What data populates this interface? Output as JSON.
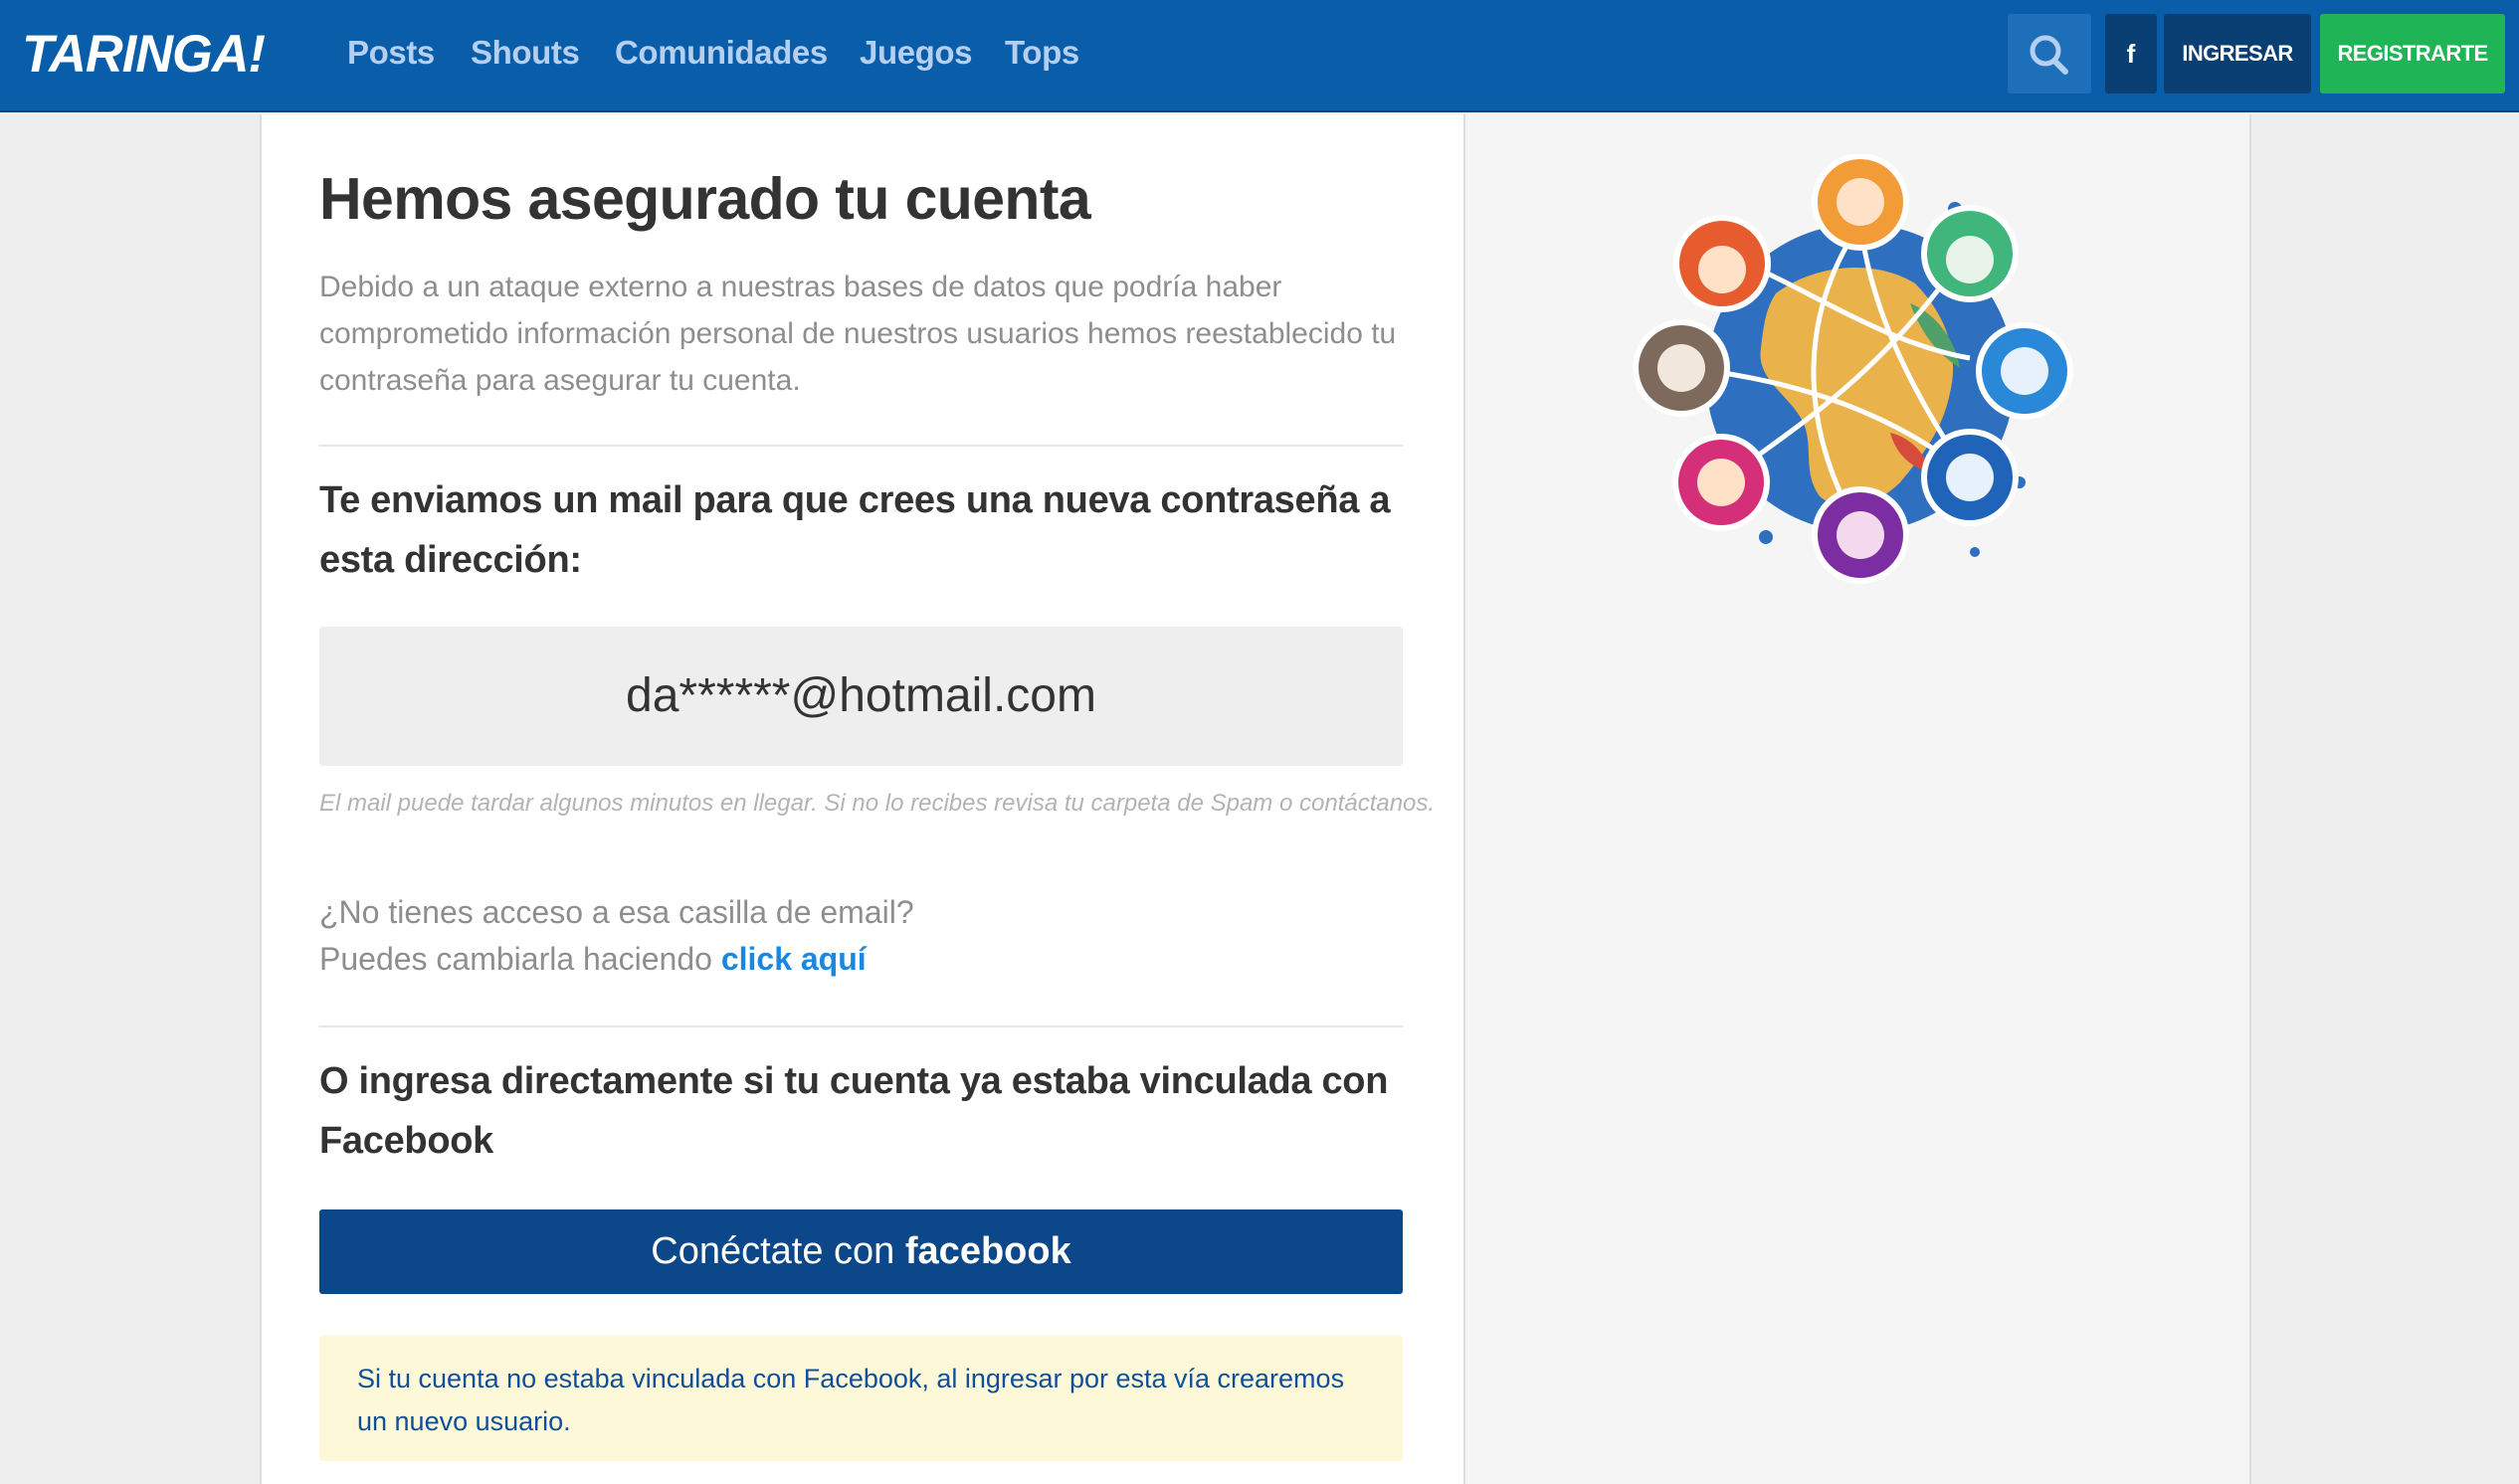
{
  "header": {
    "logo_text": "TARINGA!",
    "nav": {
      "posts": "Posts",
      "shouts": "Shouts",
      "comunidades": "Comunidades",
      "juegos": "Juegos",
      "tops": "Tops"
    },
    "search_icon": "search-icon",
    "facebook_label": "f",
    "ingresar_label": "INGRESAR",
    "registrarte_label": "REGISTRARTE"
  },
  "main": {
    "title": "Hemos asegurado tu cuenta",
    "intro": "Debido a un ataque externo a nuestras bases de datos que podría haber comprometido información personal de nuestros usuarios hemos reestablecido tu contraseña para asegurar tu cuenta.",
    "mail_heading": "Te enviamos un mail para que crees una nueva contraseña a esta dirección:",
    "email": "da******@hotmail.com",
    "mail_note": "El mail puede tardar algunos minutos en llegar. Si no lo recibes revisa tu carpeta de Spam o contáctanos.",
    "no_access_line1": "¿No tienes acceso a esa casilla de email?",
    "no_access_line2": "Puedes cambiarla haciendo",
    "change_link": "click aquí",
    "fb_heading": "O ingresa directamente si tu cuenta ya estaba vinculada con Facebook",
    "fb_button_prefix": "Conéctate con",
    "fb_button_brand": "facebook",
    "notice": "Si tu cuenta no estaba vinculada con Facebook, al ingresar por esta vía crearemos un nuevo usuario."
  },
  "sidebar": {
    "illustration": "community-globe-avatars-illustration"
  },
  "colors": {
    "header_bg": "#0a5ea9",
    "nav_text": "#b4cff0",
    "button_dark": "#0a3f73",
    "button_green": "#1fb556",
    "link_blue": "#1a88e0",
    "facebook_blue": "#0b4789",
    "notice_bg": "#fdf8d7",
    "notice_text": "#0f4f9c"
  }
}
